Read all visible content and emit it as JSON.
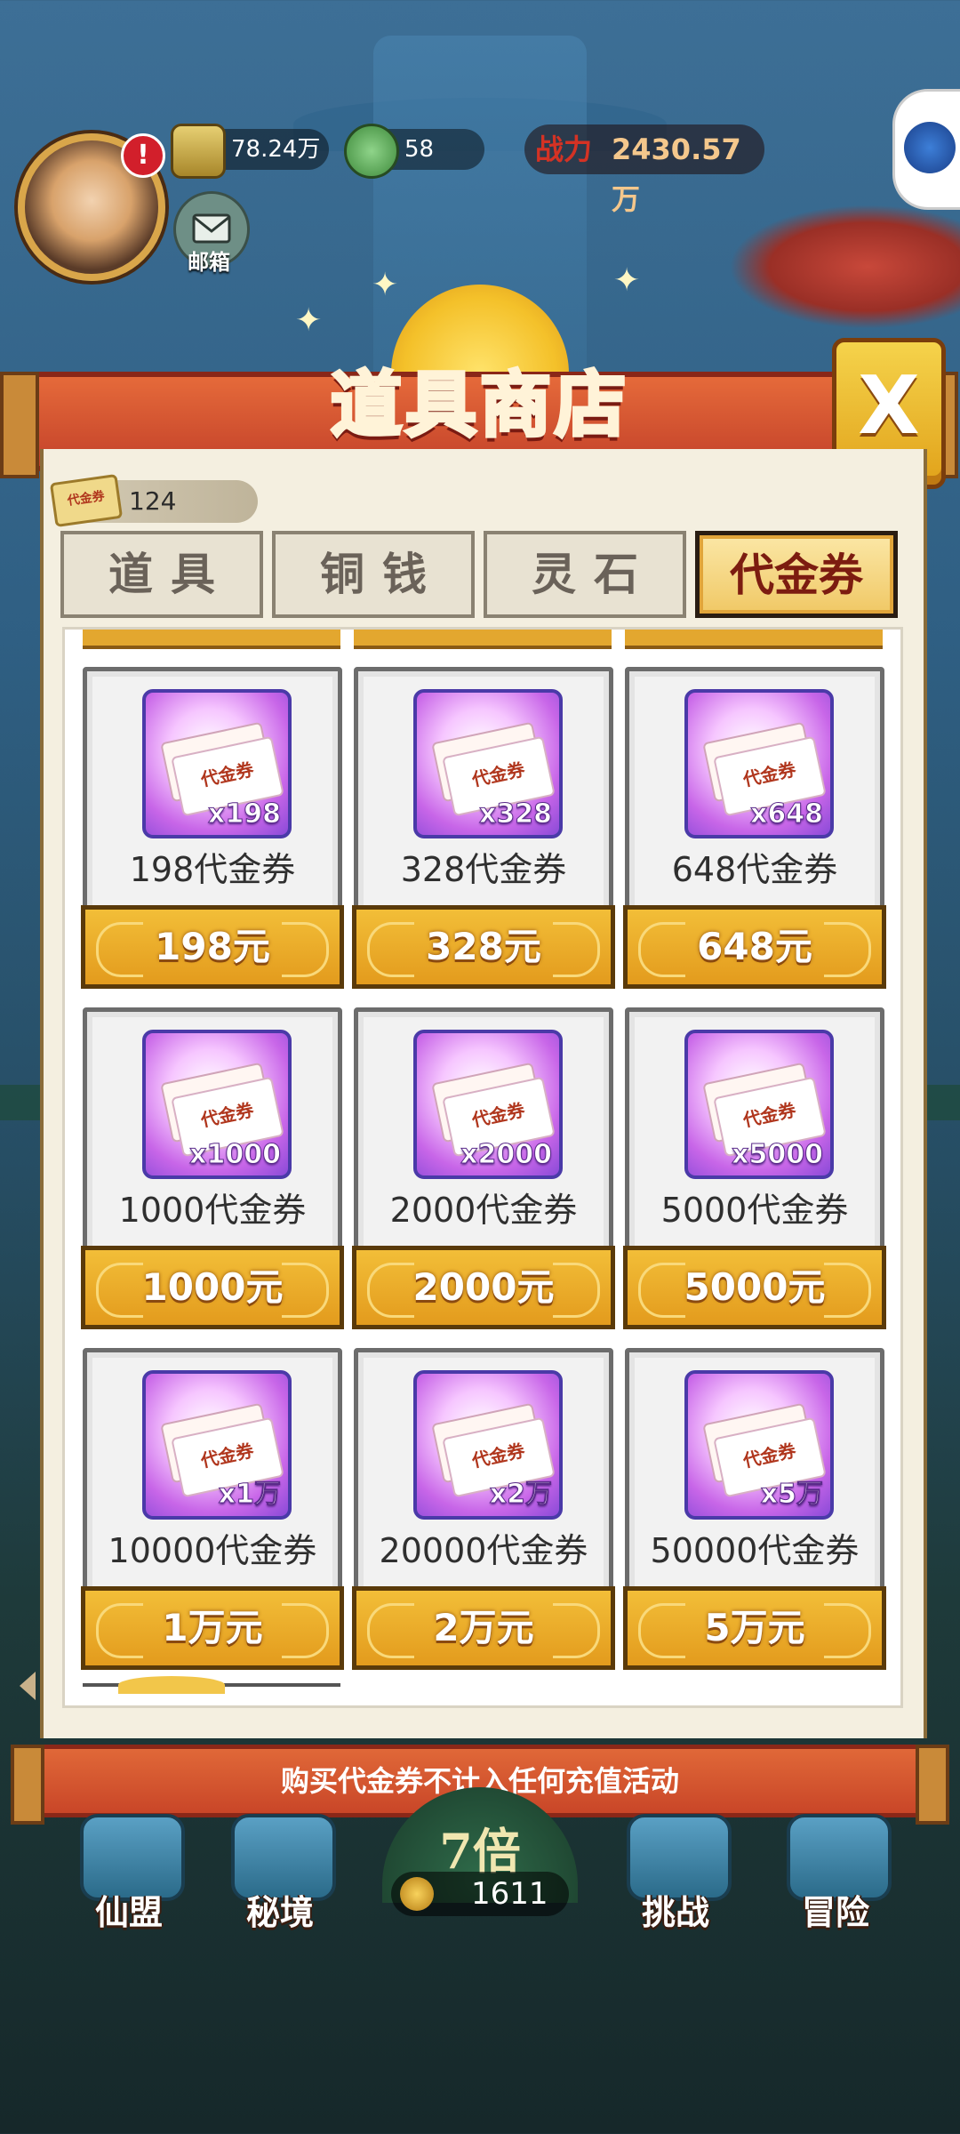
{
  "hud": {
    "copper": "78.24万",
    "spirit": "58",
    "power_label": "战力",
    "power_value": "2430.57万",
    "mail_label": "邮箱",
    "avatar_badge": "!"
  },
  "shop": {
    "title": "道具商店",
    "close_label": "X",
    "balance": "124",
    "balance_ticket_label": "代金券",
    "tabs": [
      {
        "label": "道具",
        "active": false
      },
      {
        "label": "铜钱",
        "active": false
      },
      {
        "label": "灵石",
        "active": false
      },
      {
        "label": "代金券",
        "active": true
      }
    ],
    "ticket_label": "代金券",
    "items": [
      {
        "qty": "x198",
        "name": "198代金券",
        "price": "198元"
      },
      {
        "qty": "x328",
        "name": "328代金券",
        "price": "328元"
      },
      {
        "qty": "x648",
        "name": "648代金券",
        "price": "648元"
      },
      {
        "qty": "x1000",
        "name": "1000代金券",
        "price": "1000元"
      },
      {
        "qty": "x2000",
        "name": "2000代金券",
        "price": "2000元"
      },
      {
        "qty": "x5000",
        "name": "5000代金券",
        "price": "5000元"
      },
      {
        "qty": "x1万",
        "name": "10000代金券",
        "price": "1万元"
      },
      {
        "qty": "x2万",
        "name": "20000代金券",
        "price": "2万元"
      },
      {
        "qty": "x5万",
        "name": "50000代金券",
        "price": "5万元"
      }
    ],
    "notice": "购买代金券不计入任何充值活动"
  },
  "bottom_nav": {
    "items": [
      {
        "label": "仙盟"
      },
      {
        "label": "秘境"
      },
      {
        "label": "挑战"
      },
      {
        "label": "冒险"
      }
    ],
    "center_multiplier": "7倍",
    "coins": "1611"
  }
}
